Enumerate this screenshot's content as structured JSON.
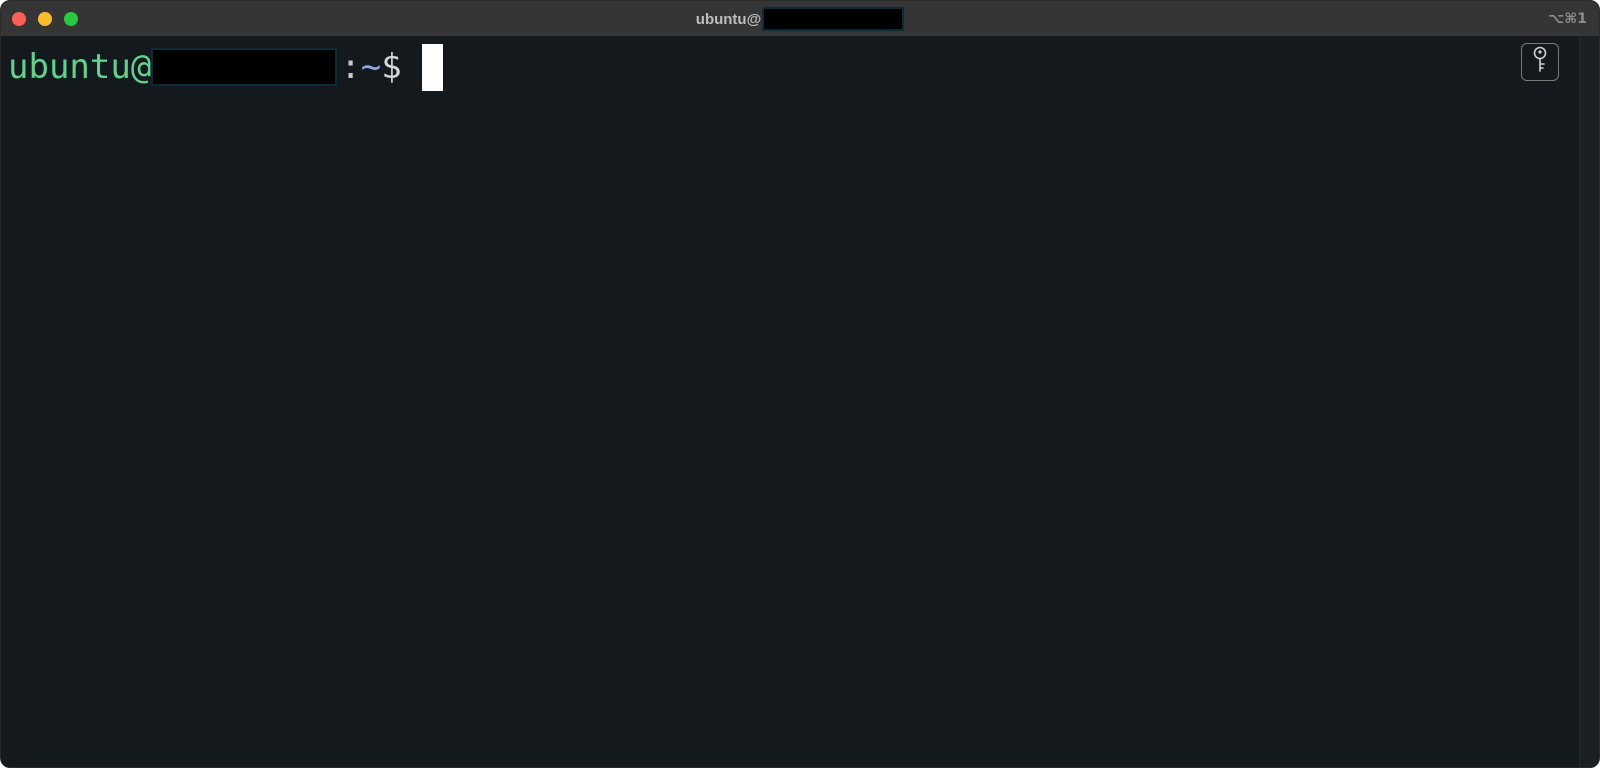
{
  "window": {
    "title_prefix": "ubuntu@",
    "shortcut": "⌥⌘1",
    "traffic_lights": {
      "close": "#ff5f57",
      "minimize": "#febc2e",
      "zoom": "#28c840"
    }
  },
  "terminal": {
    "prompt": {
      "user": "ubuntu",
      "at": "@",
      "colon": ":",
      "path": "~",
      "dollar": "$"
    },
    "colors": {
      "background": "#14191d",
      "user": "#5fd38d",
      "path": "#8fa8e8"
    },
    "key_button_icon": "key-icon"
  }
}
